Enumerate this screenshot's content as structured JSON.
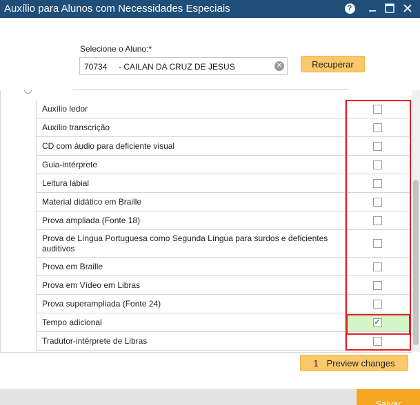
{
  "window": {
    "title": "Auxílio para Alunos com Necessidades Especiais",
    "help_glyph": "?",
    "minimize_glyph": "—",
    "maximize_glyph": "▭",
    "close_glyph": "✕"
  },
  "student": {
    "label": "Selecione o Aluno:*",
    "code": "70734",
    "name": "- CAILAN DA CRUZ DE JESUS",
    "clear_glyph": "✕",
    "recover_label": "Recuperar"
  },
  "aids": [
    {
      "label": "Auxílio ledor",
      "checked": false
    },
    {
      "label": "Auxílio transcrição",
      "checked": false
    },
    {
      "label": "CD com áudio para deficiente visual",
      "checked": false
    },
    {
      "label": "Guia-intérprete",
      "checked": false
    },
    {
      "label": "Leitura labial",
      "checked": false
    },
    {
      "label": "Material didático em Braille",
      "checked": false
    },
    {
      "label": "Prova ampliada (Fonte 18)",
      "checked": false
    },
    {
      "label": "Prova de Língua Portuguesa como Segunda Língua para surdos e deficientes auditivos",
      "checked": false
    },
    {
      "label": "Prova em Braille",
      "checked": false
    },
    {
      "label": "Prova em Vídeo em Libras",
      "checked": false
    },
    {
      "label": "Prova superampliada (Fonte 24)",
      "checked": false
    },
    {
      "label": "Tempo adicional",
      "checked": true
    },
    {
      "label": "Tradutor-intérprete de Libras",
      "checked": false
    }
  ],
  "check_glyph": "✓",
  "preview": {
    "count": "1",
    "label": "Preview changes"
  },
  "footer": {
    "save_label": "Salvar"
  },
  "colors": {
    "titlebar": "#1f4e79",
    "accent_button": "#fbc96b",
    "save_button": "#f6a623",
    "highlight": "#e0202a",
    "checked_row": "#d6f5c6"
  }
}
